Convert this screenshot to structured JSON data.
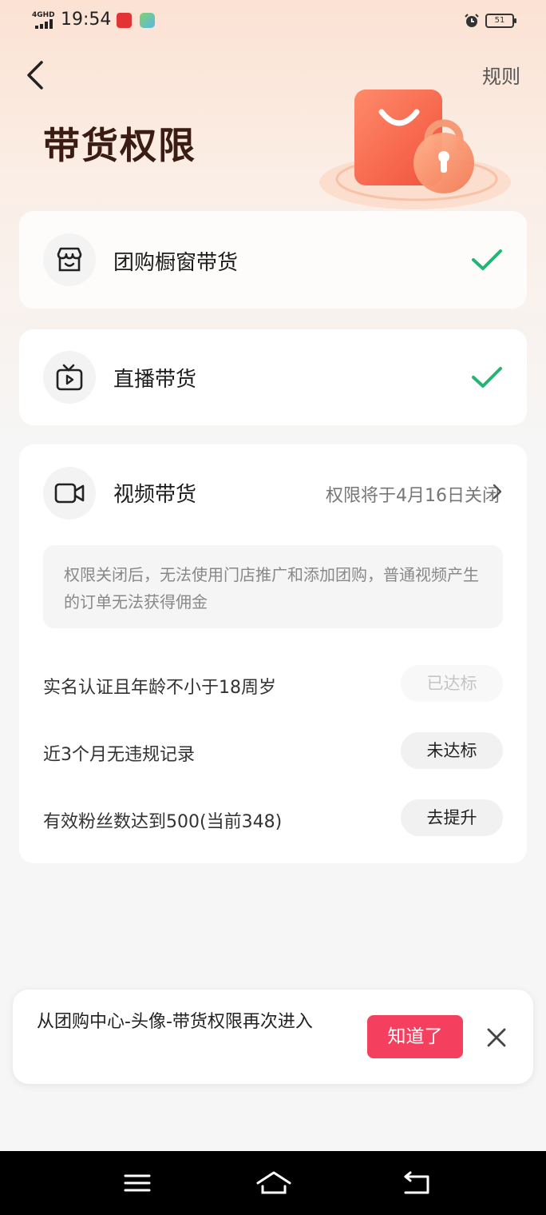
{
  "status_bar": {
    "network": "4GHD",
    "time": "19:54",
    "battery": "51"
  },
  "header": {
    "rules_label": "规则",
    "title": "带货权限"
  },
  "permissions": [
    {
      "label": "团购橱窗带货",
      "icon": "store-icon",
      "status": "enabled"
    },
    {
      "label": "直播带货",
      "icon": "live-tv-icon",
      "status": "enabled"
    }
  ],
  "video": {
    "label": "视频带货",
    "icon": "video-camera-icon",
    "close_note": "权限将于4月16日关闭",
    "notice": "权限关闭后，无法使用门店推广和添加团购，普通视频产生的订单无法获得佣金",
    "requirements": [
      {
        "label": "实名认证且年龄不小于18周岁",
        "button": "已达标",
        "met": true
      },
      {
        "label": "近3个月无违规记录",
        "button": "未达标",
        "met": false
      },
      {
        "label": "有效粉丝数达到500(当前348)",
        "button": "去提升",
        "met": false
      }
    ]
  },
  "toast": {
    "text": "从团购中心-头像-带货权限再次进入",
    "button": "知道了"
  },
  "colors": {
    "accent": "#f43f5e",
    "check": "#22b573",
    "title": "#3a1c14"
  }
}
